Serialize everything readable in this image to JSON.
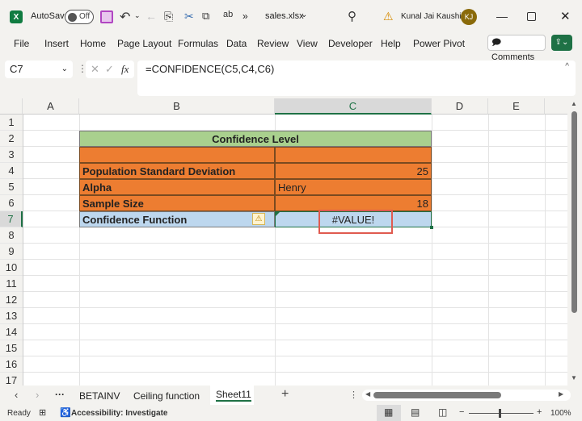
{
  "titlebar": {
    "autosave_label": "AutoSave",
    "autosave_state": "Off",
    "filename": "sales.xlsx",
    "user_name": "Kunal Jai Kaushik",
    "user_initials": "KJ",
    "more_label": "»"
  },
  "menu": [
    "File",
    "Insert",
    "Home",
    "Page Layout",
    "Formulas",
    "Data",
    "Review",
    "View",
    "Developer",
    "Help",
    "Power Pivot"
  ],
  "comments_label": "Comments",
  "formula_bar": {
    "name_box": "C7",
    "fx": "fx",
    "formula": "=CONFIDENCE(C5,C4,C6)"
  },
  "columns": [
    "A",
    "B",
    "C",
    "D",
    "E"
  ],
  "rows": [
    "1",
    "2",
    "3",
    "4",
    "5",
    "6",
    "7",
    "8",
    "9",
    "10",
    "11",
    "12",
    "13",
    "14",
    "15",
    "16",
    "17"
  ],
  "table": {
    "title": "Confidence Level",
    "rows": [
      {
        "label": "",
        "value": ""
      },
      {
        "label": "Population Standard Deviation",
        "value": "25"
      },
      {
        "label": "Alpha",
        "value": "Henry"
      },
      {
        "label": "Sample Size",
        "value": "18"
      },
      {
        "label": "Confidence Function",
        "value": "#VALUE!"
      }
    ],
    "colors": {
      "header": "#a9d08e",
      "body": "#ed7d31",
      "result": "#bdd7ee",
      "highlight_box": "#e05a4f"
    }
  },
  "sheets": {
    "tabs": [
      "BETAINV",
      "Ceiling function",
      "Sheet11"
    ],
    "active": "Sheet11",
    "ellipsis": "···",
    "add": "+"
  },
  "status": {
    "ready": "Ready",
    "accessibility": "Accessibility: Investigate",
    "zoom": "100%"
  }
}
